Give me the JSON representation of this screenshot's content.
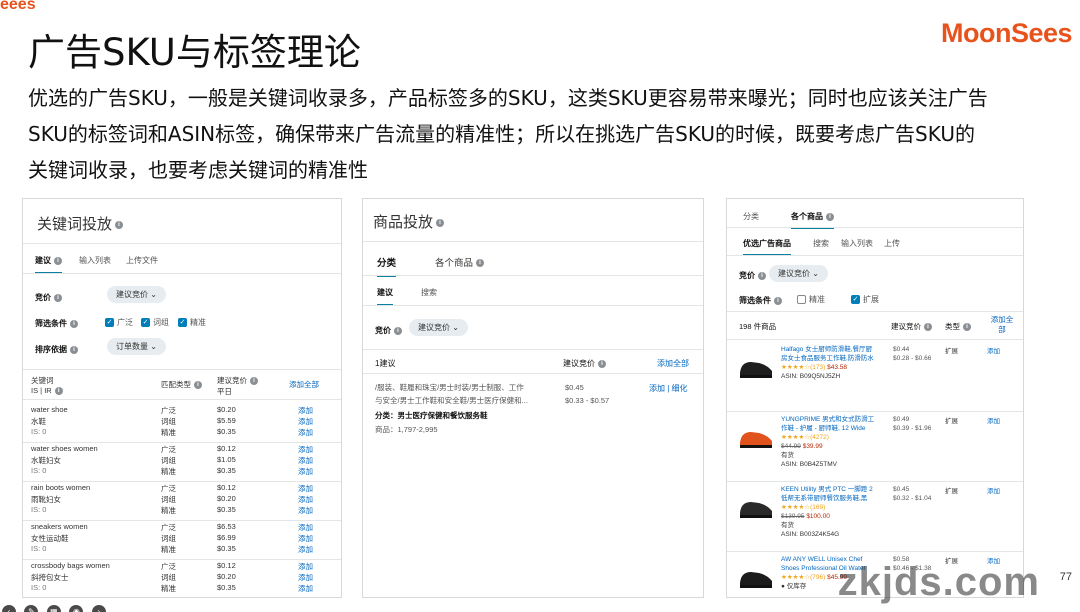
{
  "corner_logo": "eees",
  "brand_logo": "MoonSees",
  "slide": {
    "title": "广告SKU与标签理论",
    "intro_lines": [
      "优选的广告SKU，一般是关键词收录多，产品标签多的SKU，这类SKU更容易带来曝光；同时也应该关注广告",
      "SKU的标签词和ASIN标签，确保带来广告流量的精准性；所以在挑选广告SKU的时候，既要考虑广告SKU的",
      "关键词收录，也要考虑关键词的精准性"
    ]
  },
  "panel1": {
    "title": "关键词投放",
    "tabs": [
      "建议",
      "输入列表",
      "上传文件"
    ],
    "bid_label": "竞价",
    "bid_value": "建议竞价",
    "filter_label": "筛选条件",
    "filters": [
      "广泛",
      "词组",
      "精准"
    ],
    "sort_label": "排序依据",
    "sort_value": "订单数量",
    "col_keyword": "关键词",
    "col_keyword_sub": "IS | IR",
    "col_match": "匹配类型",
    "col_bid": "建议竞价",
    "col_bid_sub": "平日",
    "add_all": "添加全部",
    "rows": [
      {
        "kw": "water shoe",
        "cn": "水鞋",
        "is": "IS: 0",
        "types": [
          "广泛",
          "词组",
          "精准"
        ],
        "bids": [
          "$0.20",
          "$5.59",
          "$0.35"
        ],
        "add": "添加"
      },
      {
        "kw": "water shoes women",
        "cn": "水鞋妇女",
        "is": "IS: 0",
        "types": [
          "广泛",
          "词组",
          "精准"
        ],
        "bids": [
          "$0.12",
          "$1.05",
          "$0.35"
        ],
        "add": "添加"
      },
      {
        "kw": "rain boots women",
        "cn": "雨靴妇女",
        "is": "IS: 0",
        "types": [
          "广泛",
          "词组",
          "精准"
        ],
        "bids": [
          "$0.12",
          "$0.20",
          "$0.35"
        ],
        "add": "添加"
      },
      {
        "kw": "sneakers women",
        "cn": "女性运动鞋",
        "is": "IS: 0",
        "types": [
          "广泛",
          "词组",
          "精准"
        ],
        "bids": [
          "$6.53",
          "$6.99",
          "$0.35"
        ],
        "add": "添加"
      },
      {
        "kw": "crossbody bags women",
        "cn": "斜挎包女士",
        "is": "IS: 0",
        "types": [
          "广泛",
          "词组",
          "精准"
        ],
        "bids": [
          "$0.12",
          "$0.20",
          "$0.35"
        ],
        "add": "添加"
      }
    ]
  },
  "panel2": {
    "title": "商品投放",
    "tabs": [
      "分类",
      "各个商品"
    ],
    "subtabs": [
      "建议",
      "搜索"
    ],
    "bid_label": "竞价",
    "bid_value": "建议竞价",
    "count": "1建议",
    "col_bid": "建议竞价",
    "add_all": "添加全部",
    "path_line1": "/服装、鞋履和珠宝/男士时装/男士制服、工作",
    "path_line2": "与安全/男士工作鞋和安全鞋/男士医疗保健和...",
    "bid1": "$0.45",
    "bid_range": "$0.33 - $0.57",
    "add": "添加",
    "refine": "细化",
    "category": "分类：男士医疗保健和餐饮服务鞋",
    "goods": "商品：1,797-2,995"
  },
  "panel3": {
    "tabs": [
      "分类",
      "各个商品"
    ],
    "subtabs": [
      "优选广告商品",
      "搜索",
      "输入列表",
      "上传"
    ],
    "bid_label": "竞价",
    "bid_value": "建议竞价",
    "filter_label": "筛选条件",
    "filters": [
      "精准",
      "扩展"
    ],
    "count": "198 件商品",
    "col_bid": "建议竞价",
    "col_type": "类型",
    "add_all": "添加全部",
    "products": [
      {
        "t1": "Halfago 女士厨师防滑鞋,餐厅厨",
        "t2": "房女士食品服务工作鞋,防滑防水",
        "rating": "★★★★☆(173)",
        "price": "$43.58",
        "asin": "ASIN: B09Q5NJ5ZH",
        "bid": "$0.44",
        "range": "$0.28 - $0.66",
        "type": "扩展",
        "add": "添加"
      },
      {
        "t1": "YUNGPRIME 男式和女式防滑工",
        "t2": "作鞋 - 护履 - 厨师鞋, 12 Wide",
        "rating": "★★★★☆(4272)",
        "old": "$44.99",
        "price": "$39.99",
        "stock": "有货",
        "asin": "ASIN: B0B4Z5TMV",
        "bid": "$0.49",
        "range": "$0.39 - $1.96",
        "type": "扩展",
        "add": "添加"
      },
      {
        "t1": "KEEN Utility 男式 PTC 一脚蹬 2",
        "t2": "低帮无系带厨师餐饮服务鞋,黑",
        "rating": "★★★★☆(169)",
        "old": "$139.95",
        "price": "$100.00",
        "stock": "有货",
        "asin": "ASIN: B003Z4K54G",
        "bid": "$0.45",
        "range": "$0.32 - $1.04",
        "type": "扩展",
        "add": "添加"
      },
      {
        "t1": "AW ANY WELL Unisex Chef",
        "t2": "Shoes Professional Oil Water",
        "rating": "★★★★☆(796)",
        "price": "$45.99",
        "stock": "● 仅库存",
        "bid": "$0.58",
        "range": "$0.46 - $1.38",
        "type": "扩展",
        "add": "添加"
      }
    ]
  },
  "watermark": "zkjds.com",
  "page_number": "77"
}
